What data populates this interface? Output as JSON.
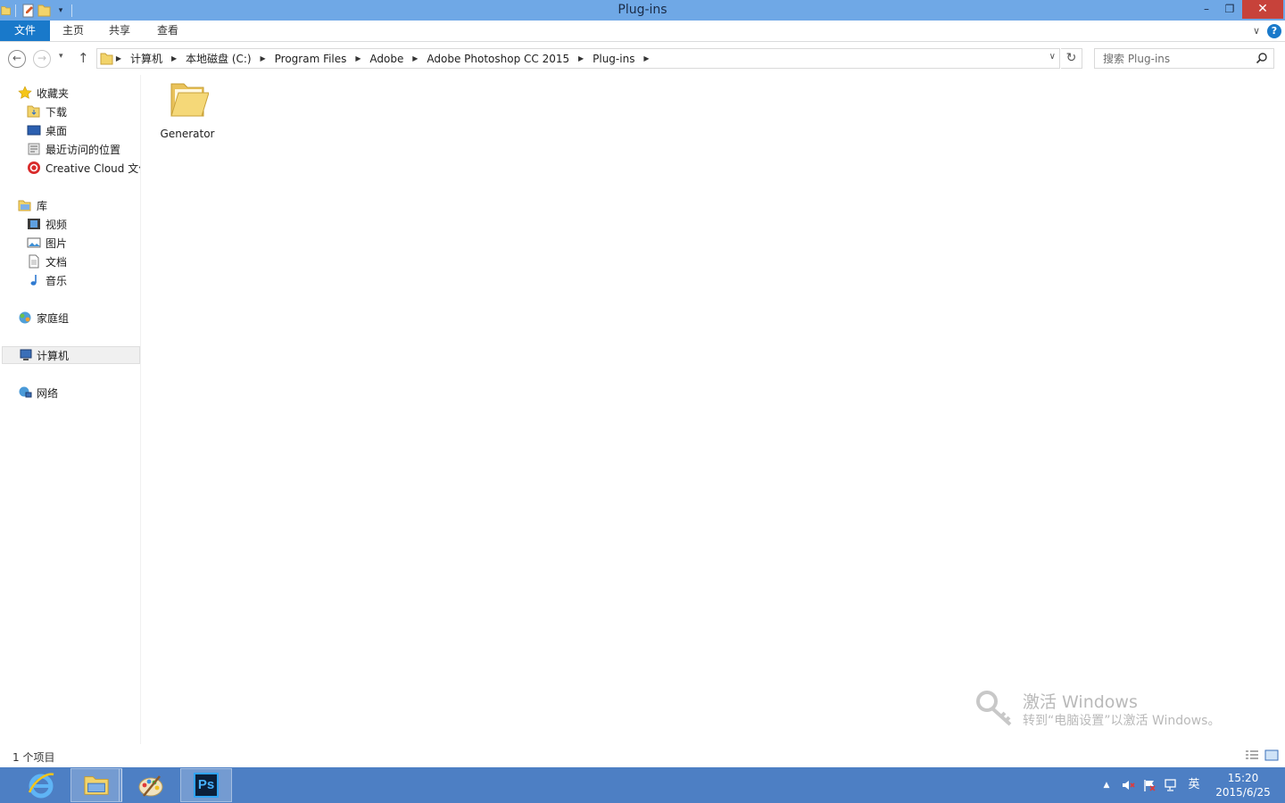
{
  "window": {
    "title": "Plug-ins"
  },
  "ribbon": {
    "tabs": [
      "文件",
      "主页",
      "共享",
      "查看"
    ]
  },
  "address": {
    "breadcrumbs": [
      "计算机",
      "本地磁盘 (C:)",
      "Program Files",
      "Adobe",
      "Adobe Photoshop CC 2015",
      "Plug-ins"
    ]
  },
  "search": {
    "placeholder": "搜索 Plug-ins"
  },
  "navpane": {
    "favorites": {
      "label": "收藏夹",
      "items": [
        "下载",
        "桌面",
        "最近访问的位置",
        "Creative Cloud 文件"
      ]
    },
    "libraries": {
      "label": "库",
      "items": [
        "视频",
        "图片",
        "文档",
        "音乐"
      ]
    },
    "homegroup": "家庭组",
    "computer": "计算机",
    "network": "网络"
  },
  "content": {
    "items": [
      {
        "name": "Generator",
        "icon": "folder-icon"
      }
    ]
  },
  "watermark": {
    "line1": "激活 Windows",
    "line2": "转到“电脑设置”以激活 Windows。"
  },
  "status": {
    "text": "1 个项目"
  },
  "taskbar": {
    "apps": [
      "internet-explorer",
      "file-explorer",
      "paint",
      "photoshop"
    ],
    "ps_label": "Ps",
    "ime": "英",
    "time": "15:20",
    "date": "2015/6/25"
  },
  "colors": {
    "titlebar": "#6fa8e6",
    "file_tab": "#1979ca",
    "taskbar": "#4d7fc4"
  }
}
